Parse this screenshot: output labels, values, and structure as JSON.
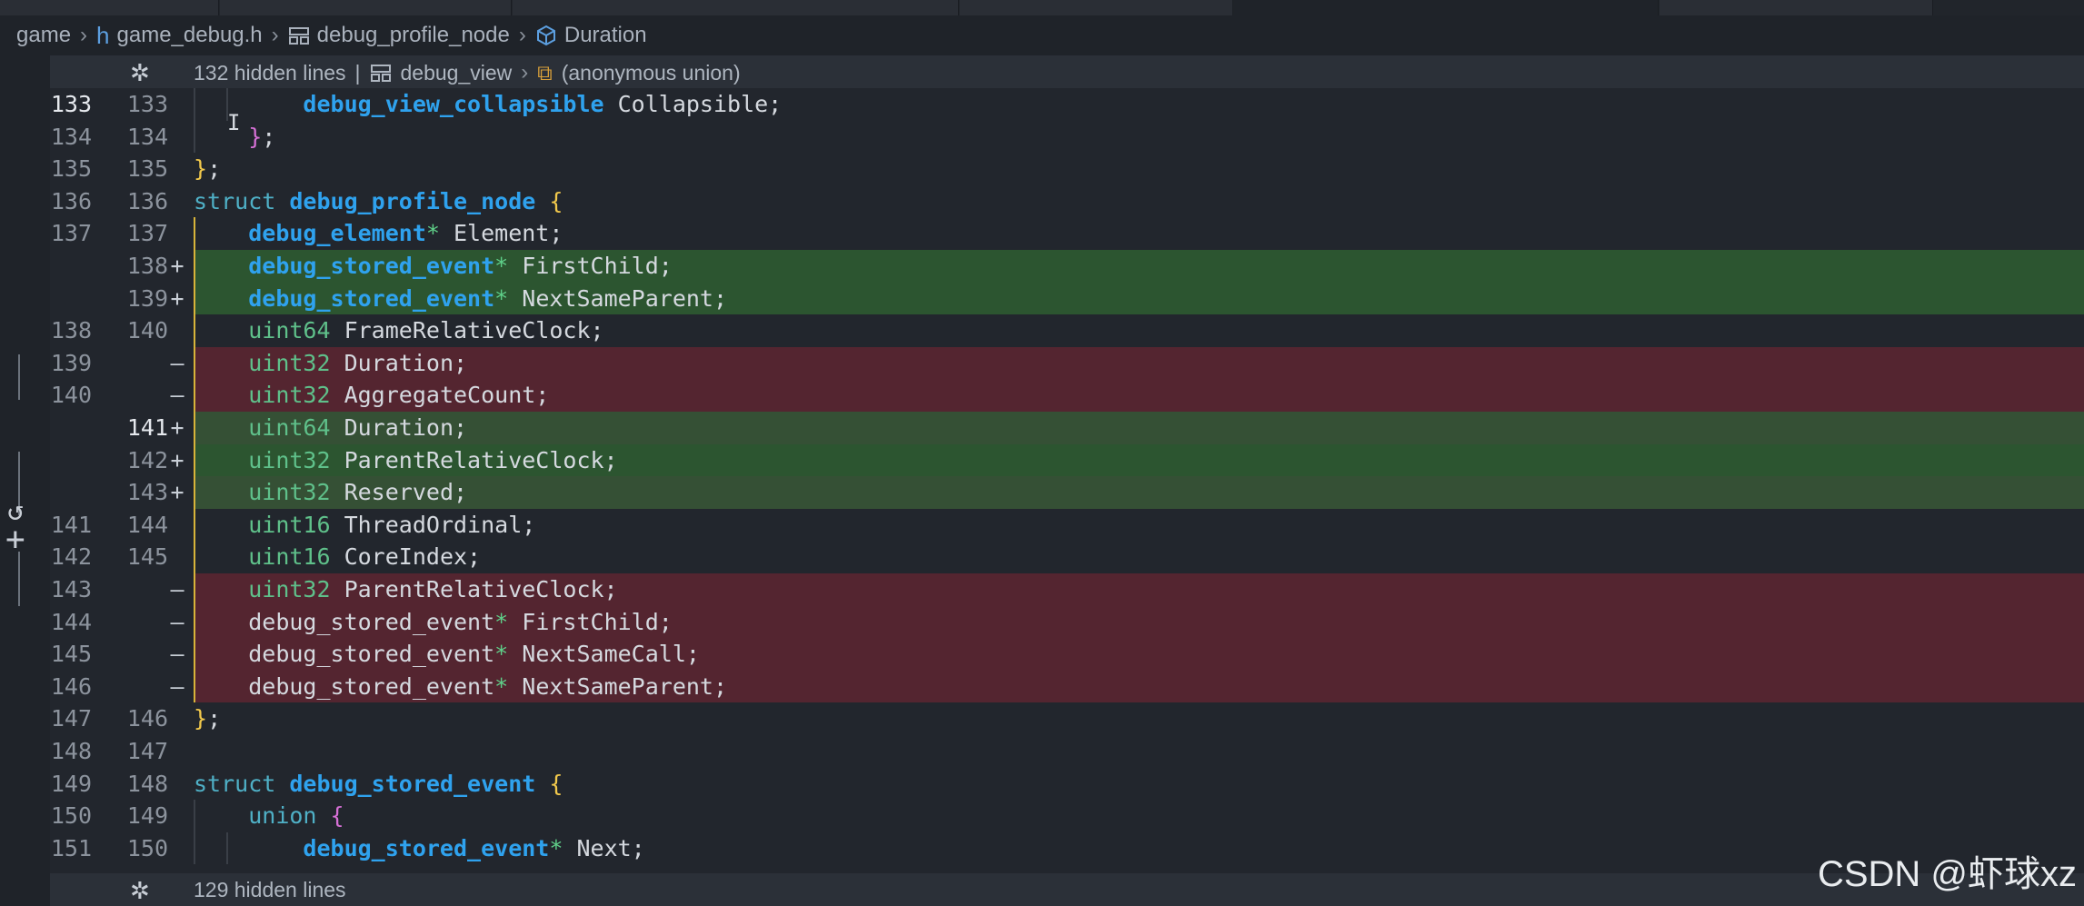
{
  "breadcrumb": {
    "items": [
      "game",
      "game_debug.h",
      "debug_profile_node",
      "Duration"
    ]
  },
  "hidden_top": {
    "label": "132 hidden lines",
    "crumbs": [
      "debug_view",
      "(anonymous union)"
    ]
  },
  "hidden_bottom": {
    "label": "129 hidden lines"
  },
  "watermark": "CSDN @虾球xz",
  "lines": [
    {
      "old": "133",
      "new": "133",
      "mark": "",
      "kind": "ctx",
      "text": "        debug_view_collapsible Collapsible;"
    },
    {
      "old": "134",
      "new": "134",
      "mark": "",
      "kind": "ctx",
      "text": "    };"
    },
    {
      "old": "135",
      "new": "135",
      "mark": "",
      "kind": "ctx",
      "text": "};"
    },
    {
      "old": "136",
      "new": "136",
      "mark": "",
      "kind": "ctx",
      "text": "struct debug_profile_node {"
    },
    {
      "old": "137",
      "new": "137",
      "mark": "",
      "kind": "ctx",
      "text": "    debug_element* Element;"
    },
    {
      "old": "",
      "new": "138",
      "mark": "+",
      "kind": "add",
      "text": "    debug_stored_event* FirstChild;"
    },
    {
      "old": "",
      "new": "139",
      "mark": "+",
      "kind": "add",
      "text": "    debug_stored_event* NextSameParent;"
    },
    {
      "old": "138",
      "new": "140",
      "mark": "",
      "kind": "ctx",
      "text": "    uint64 FrameRelativeClock;"
    },
    {
      "old": "139",
      "new": "",
      "mark": "—",
      "kind": "rem",
      "text": "    uint32 Duration;"
    },
    {
      "old": "140",
      "new": "",
      "mark": "—",
      "kind": "rem",
      "text": "    uint32 AggregateCount;"
    },
    {
      "old": "",
      "new": "141",
      "mark": "+",
      "kind": "addmod",
      "text": "    uint64 Duration;"
    },
    {
      "old": "",
      "new": "142",
      "mark": "+",
      "kind": "add",
      "text": "    uint32 ParentRelativeClock;"
    },
    {
      "old": "",
      "new": "143",
      "mark": "+",
      "kind": "addmod",
      "text": "    uint32 Reserved;"
    },
    {
      "old": "141",
      "new": "144",
      "mark": "",
      "kind": "ctx",
      "text": "    uint16 ThreadOrdinal;"
    },
    {
      "old": "142",
      "new": "145",
      "mark": "",
      "kind": "ctx",
      "text": "    uint16 CoreIndex;"
    },
    {
      "old": "143",
      "new": "",
      "mark": "—",
      "kind": "rem",
      "text": "    uint32 ParentRelativeClock;"
    },
    {
      "old": "144",
      "new": "",
      "mark": "—",
      "kind": "rem",
      "text": "    debug_stored_event* FirstChild;"
    },
    {
      "old": "145",
      "new": "",
      "mark": "—",
      "kind": "rem",
      "text": "    debug_stored_event* NextSameCall;"
    },
    {
      "old": "146",
      "new": "",
      "mark": "—",
      "kind": "rem",
      "text": "    debug_stored_event* NextSameParent;"
    },
    {
      "old": "147",
      "new": "146",
      "mark": "",
      "kind": "ctx",
      "text": "};"
    },
    {
      "old": "148",
      "new": "147",
      "mark": "",
      "kind": "ctx",
      "text": ""
    },
    {
      "old": "149",
      "new": "148",
      "mark": "",
      "kind": "ctx",
      "text": "struct debug_stored_event {"
    },
    {
      "old": "150",
      "new": "149",
      "mark": "",
      "kind": "ctx",
      "text": "    union {"
    },
    {
      "old": "151",
      "new": "150",
      "mark": "",
      "kind": "ctx",
      "text": "        debug_stored_event* Next;"
    }
  ]
}
